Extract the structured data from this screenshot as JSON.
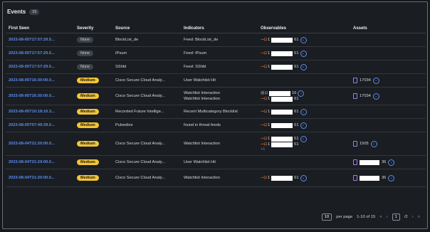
{
  "header": {
    "title": "Events",
    "count": "15"
  },
  "columns": {
    "first_seen": "First Seen",
    "severity": "Severity",
    "source": "Source",
    "indicators": "Indicators",
    "observables": "Observables",
    "assets": "Assets"
  },
  "rows": [
    {
      "first_seen": "2023-08-05T17:57:29.5...",
      "severity": "None",
      "source": "BlockList_de",
      "indicators": [
        "Feed: BlockList_de"
      ],
      "observables": [
        {
          "icon": "ip-icon",
          "text": "1",
          "tail": "61"
        }
      ],
      "assets": null
    },
    {
      "first_seen": "2023-08-05T17:57:29.5...",
      "severity": "None",
      "source": "IPsum",
      "indicators": [
        "Feed: IPsum"
      ],
      "observables": [
        {
          "icon": "ip-icon",
          "text": "1",
          "tail": "61"
        }
      ],
      "assets": null
    },
    {
      "first_seen": "2023-08-05T17:57:29.5...",
      "severity": "None",
      "source": "SShbl",
      "indicators": [
        "Feed: SShbl"
      ],
      "observables": [
        {
          "icon": "ip-icon",
          "text": "1",
          "tail": "61"
        }
      ],
      "assets": null
    },
    {
      "first_seen": "2023-08-05T16:30:00.0...",
      "severity": "Medium",
      "source": "Cisco Secure Cloud Analy...",
      "indicators": [
        "User Watchlist Hit"
      ],
      "observables": [],
      "assets": "17034"
    },
    {
      "first_seen": "2023-08-05T16:30:00.0...",
      "severity": "Medium",
      "source": "Cisco Secure Cloud Analy...",
      "indicators": [
        "Watchlist Interaction",
        "Watchlist Interaction"
      ],
      "observables": [
        {
          "icon": "at-icon",
          "text": "",
          "tail": "16"
        },
        {
          "icon": "ip-icon",
          "text": "1",
          "tail": "61"
        }
      ],
      "assets": "17034"
    },
    {
      "first_seen": "2023-08-05T10:18:16.3...",
      "severity": "Medium",
      "source": "Recorded Future Intellige...",
      "indicators": [
        "Recent Multicategory Blocklist"
      ],
      "observables": [
        {
          "icon": "ip-icon",
          "text": "1",
          "tail": "61"
        }
      ],
      "assets": null
    },
    {
      "first_seen": "2023-08-05T07:49:39.0...",
      "severity": "Medium",
      "source": "Pulsedive",
      "indicators": [
        "found in threat feeds"
      ],
      "observables": [
        {
          "icon": "ip-icon",
          "text": "1",
          "tail": "61"
        }
      ],
      "assets": null
    },
    {
      "first_seen": "2023-08-04T21:20:00.0...",
      "severity": "Medium",
      "source": "Cisco Secure Cloud Analy...",
      "indicators": [
        "Watchlist Interaction"
      ],
      "observables": [
        {
          "icon": "ip-icon",
          "text": "1",
          "tail": "51"
        },
        {
          "icon": "ip-icon",
          "text": "1",
          "tail": "51"
        }
      ],
      "more": "+1",
      "assets": "1505"
    },
    {
      "first_seen": "2023-08-04T21:20:00.0...",
      "severity": "Medium",
      "source": "Cisco Secure Cloud Analy...",
      "indicators": [
        "User Watchlist Hit"
      ],
      "observables": [],
      "assets": "36",
      "asset_redacted": true
    },
    {
      "first_seen": "2023-08-04T21:20:00.0...",
      "severity": "Medium",
      "source": "Cisco Secure Cloud Analy...",
      "indicators": [
        "Watchlist Interaction"
      ],
      "observables": [
        {
          "icon": "ip-icon",
          "text": "1",
          "tail": "61"
        }
      ],
      "assets": "36",
      "asset_redacted": true
    }
  ],
  "pagination": {
    "per_page_value": "10",
    "per_page_label": "per page",
    "range": "1-10 of 15",
    "first": "«",
    "prev": "‹",
    "current_page": "1",
    "total_pages": "/2",
    "next": "›",
    "last": "»"
  },
  "colors": {
    "link": "#5b8df0",
    "medium": "#f2c433",
    "none": "#3d4248",
    "ip_icon": "#f07c3c",
    "asset_icon": "#a37cf0"
  }
}
